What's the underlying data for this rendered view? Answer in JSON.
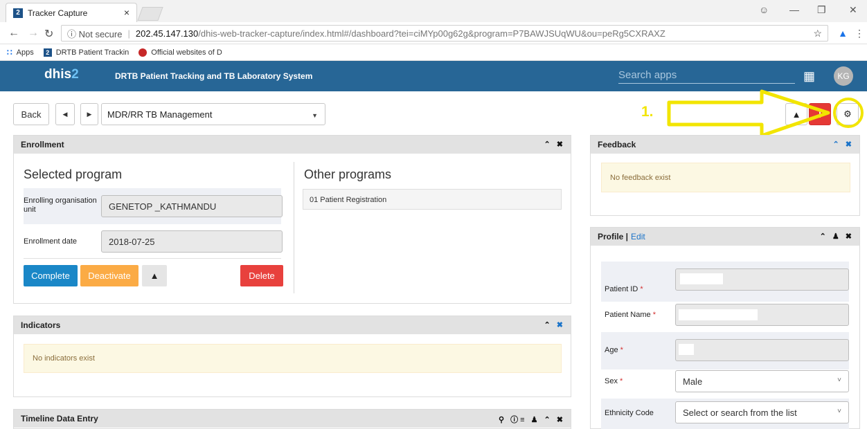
{
  "browser": {
    "tab_title": "Tracker Capture",
    "tab_favicon": "2",
    "tab_close": "×",
    "address_security": "ⓘ Not secure",
    "address_host": "202.45.147.130",
    "address_path": "/dhis-web-tracker-capture/index.html#/dashboard?tei=ciMYp00g62g&program=P7BAWJSUqWU&ou=peRg5CXRAXZ",
    "bookmarks": {
      "apps": "Apps",
      "item1": "DRTB Patient Trackin",
      "item2": "Official websites of D"
    }
  },
  "header": {
    "logo_text": "dhis",
    "logo_num": "2",
    "system_title": "DRTB Patient Tracking and TB Laboratory System",
    "search_placeholder": "Search apps",
    "avatar_initials": "KG"
  },
  "controls": {
    "back_label": "Back",
    "program_selected": "MDR/RR TB Management"
  },
  "annotation": {
    "step_label": "1.",
    "color": "#f2e500"
  },
  "enrollment": {
    "title": "Enrollment",
    "selected_program_title": "Selected program",
    "org_unit_label": "Enrolling organisation unit",
    "org_unit_value": "GENETOP _KATHMANDU",
    "date_label": "Enrollment date",
    "date_value": "2018-07-25",
    "complete_label": "Complete",
    "deactivate_label": "Deactivate",
    "delete_label": "Delete",
    "other_programs_title": "Other programs",
    "other_programs": [
      "01 Patient Registration"
    ]
  },
  "indicators": {
    "title": "Indicators",
    "empty_text": "No indicators exist"
  },
  "timeline": {
    "title": "Timeline Data Entry"
  },
  "feedback": {
    "title": "Feedback",
    "empty_text": "No feedback exist"
  },
  "profile": {
    "title": "Profile |",
    "edit_label": "Edit",
    "fields": {
      "patient_id": "Patient ID",
      "patient_name": "Patient Name",
      "age": "Age",
      "sex": "Sex",
      "sex_value": "Male",
      "ethnicity": "Ethnicity Code",
      "ethnicity_placeholder": "Select or search from the list"
    }
  },
  "colors": {
    "header_bg": "#276696",
    "primary_button": "#1a87c7",
    "warning_button": "#fbab45",
    "danger_button": "#e8413d"
  }
}
